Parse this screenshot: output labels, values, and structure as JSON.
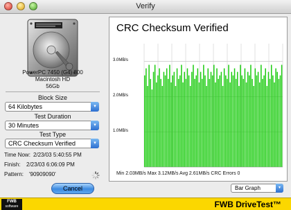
{
  "window": {
    "title": "Verify"
  },
  "disk": {
    "model": "PowerPC 7450 (G4) 800",
    "volume": "Macintosh HD",
    "capacity": "56Gb"
  },
  "settings": {
    "block_size_label": "Block Size",
    "block_size_value": "64 Kilobytes",
    "test_duration_label": "Test Duration",
    "test_duration_value": "30 Minutes",
    "test_type_label": "Test Type",
    "test_type_value": "CRC Checksum Verified"
  },
  "status": {
    "time_now_label": "Time Now:",
    "time_now_value": "2/23/03 5:40:55 PM",
    "finish_label": "Finish:",
    "finish_value": "2/23/03 6:06:09 PM",
    "pattern_label": "Pattern:",
    "pattern_value": "'90909090'"
  },
  "buttons": {
    "cancel_label": "Cancel"
  },
  "graph_selector": {
    "value": "Bar Graph"
  },
  "footer": {
    "logo_top": "FWB",
    "logo_bottom": "software",
    "brand": "FWB DriveTest™"
  },
  "colors": {
    "bar": "#1ecc12",
    "accent": "#3d8ae0",
    "footer": "#fbd700"
  },
  "chart_data": {
    "type": "bar",
    "title": "CRC Checksum Verified",
    "y_unit": "MB/s",
    "ylim": [
      0,
      3.5
    ],
    "y_ticks": [
      {
        "value": 1.0,
        "label": "1.0MB/s"
      },
      {
        "value": 2.0,
        "label": "2.0MB/s"
      },
      {
        "value": 3.0,
        "label": "3.0MB/s"
      }
    ],
    "grid": true,
    "stats_text": "Min 2.03MB/s Max 3.12MB/s Avg 2.61MB/s CRC Errors 0",
    "values": [
      2.6,
      2.8,
      2.3,
      2.9,
      2.5,
      2.2,
      2.7,
      2.9,
      2.4,
      2.6,
      2.8,
      2.5,
      2.3,
      2.7,
      2.6,
      2.8,
      2.5,
      2.9,
      2.4,
      2.6,
      2.7,
      2.3,
      2.8,
      2.5,
      2.6,
      2.9,
      2.4,
      2.7,
      2.5,
      2.8,
      2.6,
      2.3,
      2.7,
      2.9,
      2.5,
      2.6,
      2.8,
      2.4,
      2.7,
      2.5,
      2.9,
      2.6,
      2.3,
      2.8,
      2.5,
      2.7,
      2.6,
      2.9,
      2.4,
      2.8,
      2.5,
      2.6,
      2.7,
      2.3,
      2.8,
      2.6,
      2.5,
      2.9,
      2.4,
      2.7,
      2.6,
      2.8,
      2.5,
      2.7,
      2.3,
      2.9,
      2.6,
      2.5,
      2.8,
      2.4,
      2.7,
      2.6,
      2.9,
      2.5,
      2.3,
      2.8,
      2.6,
      2.7,
      2.4,
      2.9,
      2.5,
      2.6,
      2.8,
      2.3,
      2.7,
      2.5,
      2.9,
      2.6,
      2.4,
      2.8,
      2.7,
      2.5,
      2.6,
      2.9
    ]
  }
}
